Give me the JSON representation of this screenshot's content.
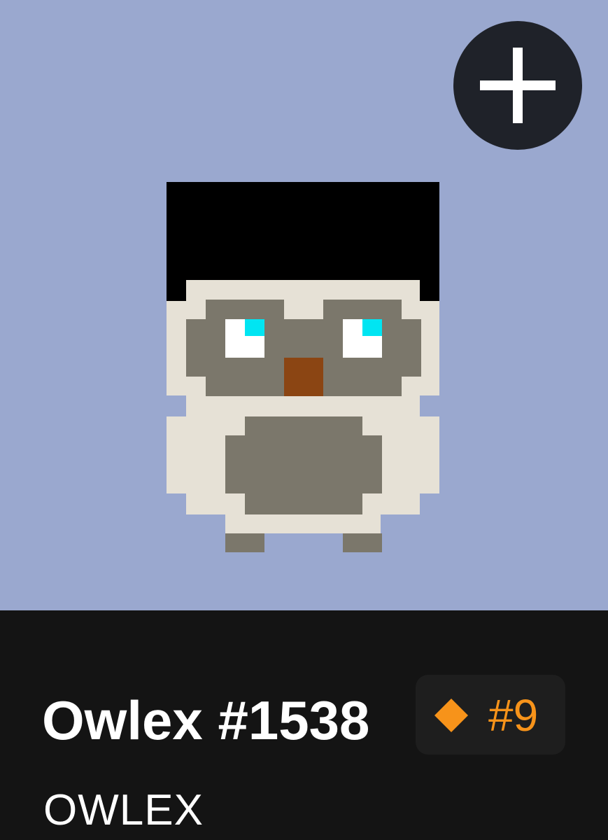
{
  "nft": {
    "name": "Owlex #1538",
    "collection": "OWLEX",
    "rank_label": "#9"
  },
  "icons": {
    "add_button": "plus-icon",
    "rank_badge": "diamond-icon"
  },
  "colors": {
    "art_background": "#9aa8cf",
    "panel_background": "#141414",
    "rank_accent": "#f7931a",
    "add_button_background": "#1f2229"
  }
}
